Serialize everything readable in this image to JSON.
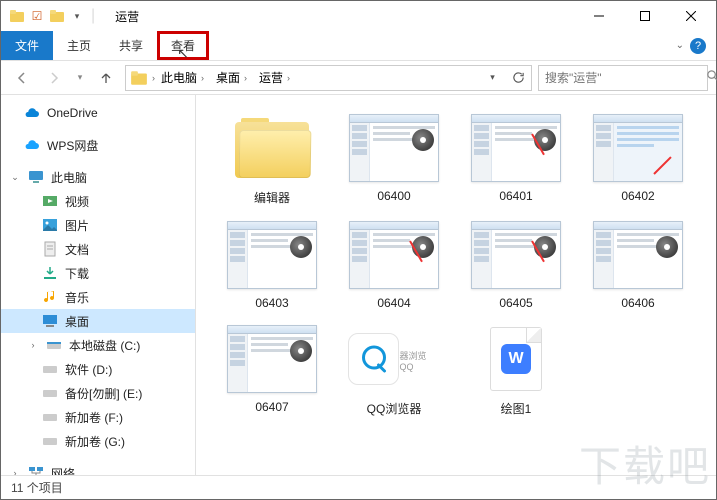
{
  "titlebar": {
    "title": "运营"
  },
  "ribbon": {
    "file": "文件",
    "home": "主页",
    "share": "共享",
    "view": "查看"
  },
  "nav": {
    "crumbs": [
      "此电脑",
      "桌面",
      "运营"
    ],
    "search_placeholder": "搜索\"运营\""
  },
  "sidebar": {
    "onedrive": "OneDrive",
    "wps": "WPS网盘",
    "thispc": "此电脑",
    "videos": "视频",
    "pictures": "图片",
    "documents": "文档",
    "downloads": "下载",
    "music": "音乐",
    "desktop": "桌面",
    "cdisk": "本地磁盘 (C:)",
    "ddisk": "软件 (D:)",
    "edisk": "备份[勿删] (E:)",
    "fdisk": "新加卷 (F:)",
    "gdisk": "新加卷 (G:)",
    "network": "网络"
  },
  "items": [
    {
      "name": "编辑器",
      "kind": "folder"
    },
    {
      "name": "06400",
      "kind": "media"
    },
    {
      "name": "06401",
      "kind": "media",
      "arrow": true
    },
    {
      "name": "06402",
      "kind": "screenshot"
    },
    {
      "name": "06403",
      "kind": "media"
    },
    {
      "name": "06404",
      "kind": "media",
      "arrow": true
    },
    {
      "name": "06405",
      "kind": "media",
      "arrow": true
    },
    {
      "name": "06406",
      "kind": "media"
    },
    {
      "name": "06407",
      "kind": "media"
    },
    {
      "name": "QQ浏览器",
      "kind": "qq"
    },
    {
      "name": "绘图1",
      "kind": "wps"
    }
  ],
  "status": {
    "count_label": "11 个项目"
  },
  "watermark": "下载吧"
}
